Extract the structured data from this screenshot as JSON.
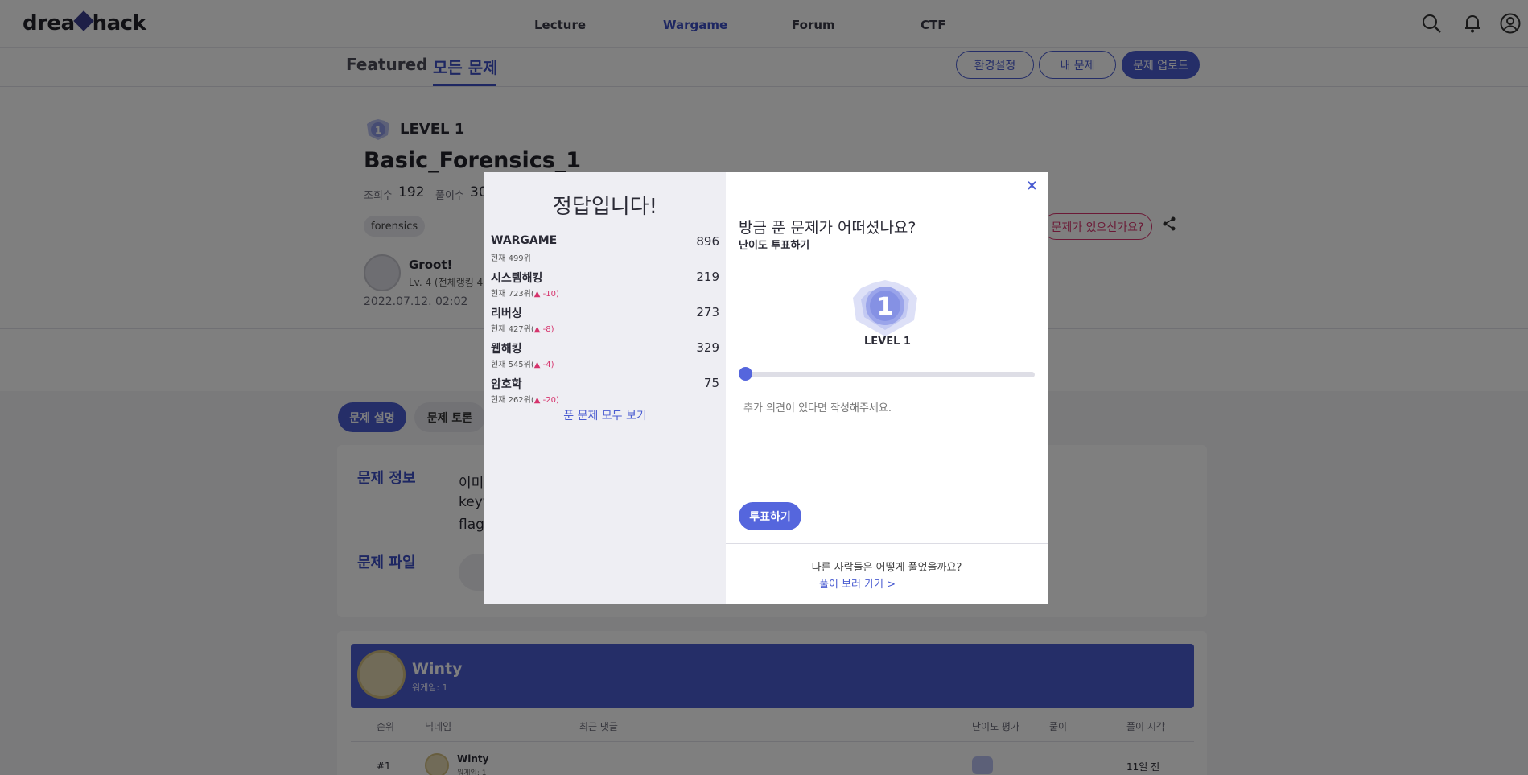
{
  "header": {
    "logo": "dreamhack",
    "nav": [
      "Lecture",
      "Wargame",
      "Forum",
      "CTF"
    ],
    "active_nav": "Wargame"
  },
  "subnav": {
    "tabs": [
      "Featured",
      "모든 문제"
    ],
    "buttons": [
      "환경설정",
      "내 문제",
      "문제 업로드"
    ]
  },
  "challenge": {
    "level": "LEVEL 1",
    "title": "Basic_Forensics_1",
    "views_label": "조회수",
    "views": "192",
    "solves_label": "풀이수",
    "solves": "30",
    "tag": "forensics",
    "author": "Groot!",
    "author_level": "Lv. 4 (전체랭킹 40",
    "date": "2022.07.12. 02:02",
    "report_label": "문제가 있으신가요?"
  },
  "body_tabs": [
    "문제 설명",
    "문제 토론"
  ],
  "desc": {
    "info_label": "문제 정보",
    "file_label": "문제 파일",
    "lines": [
      "이미",
      "keyw",
      "flag"
    ]
  },
  "solver": {
    "name": "Winty",
    "sub": "워게임: 1",
    "columns": [
      "순위",
      "닉네임",
      "최근 댓글",
      "난이도 평가",
      "풀이",
      "풀이 시각"
    ],
    "rows": [
      {
        "rank": "#1",
        "name": "Winty",
        "sub": "워게임: 1",
        "time": "11일 전"
      }
    ]
  },
  "modal": {
    "title": "정답입니다!",
    "categories": [
      {
        "name": "WARGAME",
        "score": "896",
        "rank": "현재 499위",
        "change": ""
      },
      {
        "name": "시스템해킹",
        "score": "219",
        "rank": "현재 723위(",
        "change": "▲ -10)"
      },
      {
        "name": "리버싱",
        "score": "273",
        "rank": "현재 427위(",
        "change": "▲ -8)"
      },
      {
        "name": "웹해킹",
        "score": "329",
        "rank": "현재 545위(",
        "change": "▲ -4)"
      },
      {
        "name": "암호학",
        "score": "75",
        "rank": "현재 262위(",
        "change": "▲ -20)"
      }
    ],
    "see_all": "푼 문제 모두 보기",
    "close": "×",
    "question": "방금 푼 문제가 어떠셨나요?",
    "vote_sub": "난이도 투표하기",
    "level_label": "LEVEL 1",
    "level_value": 1,
    "comment_placeholder": "추가 의견이 있다면 작성해주세요.",
    "vote_button": "투표하기",
    "other_question": "다른 사람들은 어떻게 풀었을까요?",
    "other_link": "풀이 보러 가기 >"
  },
  "colors": {
    "accent": "#4a5cd1",
    "danger": "#d6336c"
  }
}
